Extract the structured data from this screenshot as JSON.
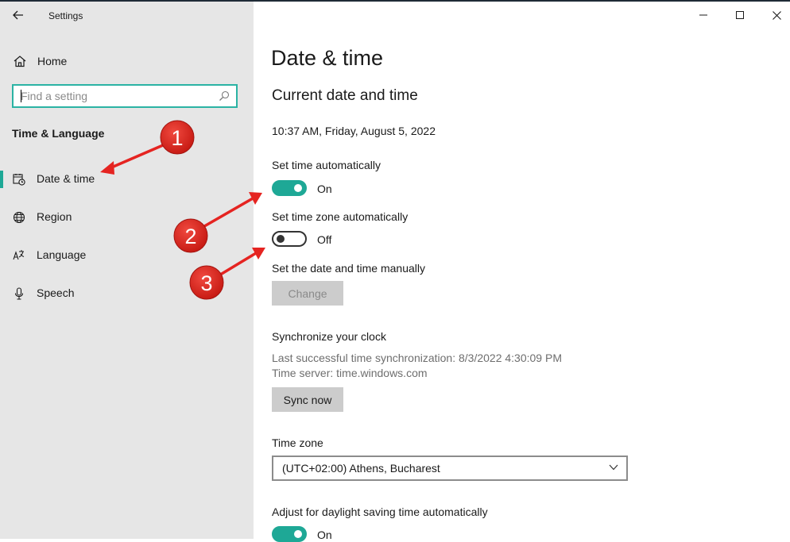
{
  "window": {
    "title": "Settings"
  },
  "sidebar": {
    "home_label": "Home",
    "search_placeholder": "Find a setting",
    "section_header": "Time & Language",
    "items": [
      {
        "label": "Date & time",
        "icon": "calendar-clock-icon",
        "selected": true
      },
      {
        "label": "Region",
        "icon": "globe-icon",
        "selected": false
      },
      {
        "label": "Language",
        "icon": "language-icon",
        "selected": false
      },
      {
        "label": "Speech",
        "icon": "microphone-icon",
        "selected": false
      }
    ]
  },
  "main": {
    "title": "Date & time",
    "subheading": "Current date and time",
    "current_datetime": "10:37 AM, Friday, August 5, 2022",
    "set_time_auto": {
      "label": "Set time automatically",
      "state": "On"
    },
    "set_timezone_auto": {
      "label": "Set time zone automatically",
      "state": "Off"
    },
    "manual": {
      "label": "Set the date and time manually",
      "button": "Change"
    },
    "sync": {
      "heading": "Synchronize your clock",
      "last_sync": "Last successful time synchronization: 8/3/2022 4:30:09 PM",
      "server": "Time server: time.windows.com",
      "button": "Sync now"
    },
    "timezone": {
      "label": "Time zone",
      "value": "(UTC+02:00) Athens, Bucharest"
    },
    "dst": {
      "label": "Adjust for daylight saving time automatically",
      "state": "On"
    }
  },
  "annotations": {
    "marker_1": "1",
    "marker_2": "2",
    "marker_3": "3"
  },
  "colors": {
    "accent": "#1ea896",
    "sidebar_bg": "#e6e6e6",
    "annotation": "#e52421"
  }
}
